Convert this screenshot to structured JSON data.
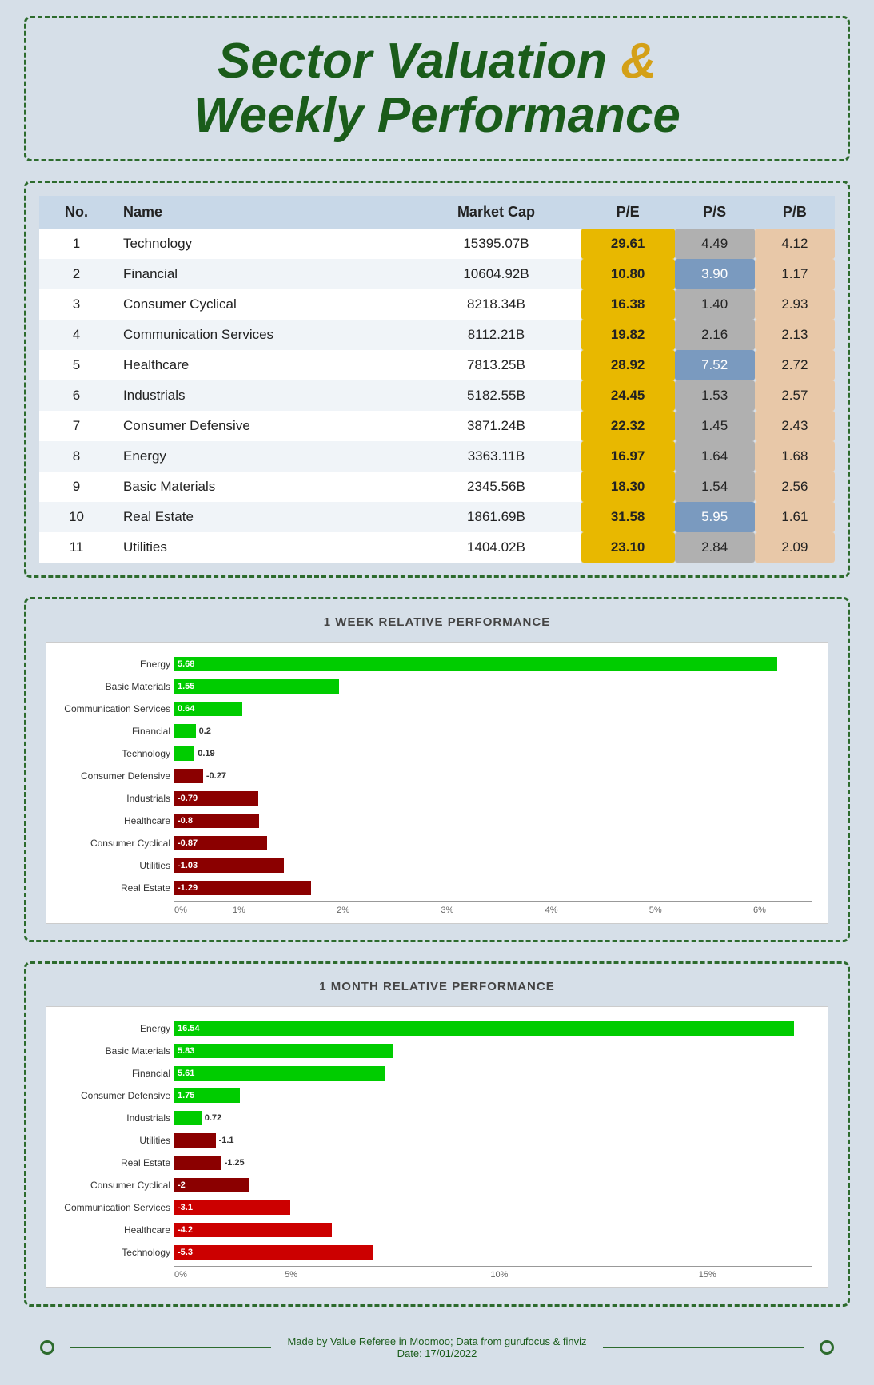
{
  "title": {
    "line1": "Sector Valuation ",
    "ampersand": "&",
    "line2": "Weekly Performance"
  },
  "table": {
    "headers": [
      "No.",
      "Name",
      "Market Cap",
      "P/E",
      "P/S",
      "P/B"
    ],
    "rows": [
      {
        "no": 1,
        "name": "Technology",
        "market_cap": "15395.07B",
        "pe": "29.61",
        "ps": "4.49",
        "pb": "4.12"
      },
      {
        "no": 2,
        "name": "Financial",
        "market_cap": "10604.92B",
        "pe": "10.80",
        "ps": "3.90",
        "pb": "1.17"
      },
      {
        "no": 3,
        "name": "Consumer Cyclical",
        "market_cap": "8218.34B",
        "pe": "16.38",
        "ps": "1.40",
        "pb": "2.93"
      },
      {
        "no": 4,
        "name": "Communication Services",
        "market_cap": "8112.21B",
        "pe": "19.82",
        "ps": "2.16",
        "pb": "2.13"
      },
      {
        "no": 5,
        "name": "Healthcare",
        "market_cap": "7813.25B",
        "pe": "28.92",
        "ps": "7.52",
        "pb": "2.72"
      },
      {
        "no": 6,
        "name": "Industrials",
        "market_cap": "5182.55B",
        "pe": "24.45",
        "ps": "1.53",
        "pb": "2.57"
      },
      {
        "no": 7,
        "name": "Consumer Defensive",
        "market_cap": "3871.24B",
        "pe": "22.32",
        "ps": "1.45",
        "pb": "2.43"
      },
      {
        "no": 8,
        "name": "Energy",
        "market_cap": "3363.11B",
        "pe": "16.97",
        "ps": "1.64",
        "pb": "1.68"
      },
      {
        "no": 9,
        "name": "Basic Materials",
        "market_cap": "2345.56B",
        "pe": "18.30",
        "ps": "1.54",
        "pb": "2.56"
      },
      {
        "no": 10,
        "name": "Real Estate",
        "market_cap": "1861.69B",
        "pe": "31.58",
        "ps": "5.95",
        "pb": "1.61"
      },
      {
        "no": 11,
        "name": "Utilities",
        "market_cap": "1404.02B",
        "pe": "23.10",
        "ps": "2.84",
        "pb": "2.09"
      }
    ]
  },
  "week_chart": {
    "title": "1 WEEK RELATIVE PERFORMANCE",
    "bars": [
      {
        "label": "Energy",
        "value": 5.68
      },
      {
        "label": "Basic Materials",
        "value": 1.55
      },
      {
        "label": "Communication Services",
        "value": 0.64
      },
      {
        "label": "Financial",
        "value": 0.2
      },
      {
        "label": "Technology",
        "value": 0.19
      },
      {
        "label": "Consumer Defensive",
        "value": -0.27
      },
      {
        "label": "Industrials",
        "value": -0.79
      },
      {
        "label": "Healthcare",
        "value": -0.8
      },
      {
        "label": "Consumer Cyclical",
        "value": -0.87
      },
      {
        "label": "Utilities",
        "value": -1.03
      },
      {
        "label": "Real Estate",
        "value": -1.29
      }
    ],
    "x_ticks": [
      "0%",
      "1%",
      "2%",
      "3%",
      "4%",
      "5%",
      "6%"
    ],
    "max": 6
  },
  "month_chart": {
    "title": "1 MONTH RELATIVE PERFORMANCE",
    "bars": [
      {
        "label": "Energy",
        "value": 16.54
      },
      {
        "label": "Basic Materials",
        "value": 5.83
      },
      {
        "label": "Financial",
        "value": 5.61
      },
      {
        "label": "Consumer Defensive",
        "value": 1.75
      },
      {
        "label": "Industrials",
        "value": 0.72
      },
      {
        "label": "Utilities",
        "value": -1.1
      },
      {
        "label": "Real Estate",
        "value": -1.25
      },
      {
        "label": "Consumer Cyclical",
        "value": -2
      },
      {
        "label": "Communication Services",
        "value": -3.1
      },
      {
        "label": "Healthcare",
        "value": -4.2
      },
      {
        "label": "Technology",
        "value": -5.3
      }
    ],
    "x_ticks": [
      "0%",
      "5%",
      "10%",
      "15%"
    ],
    "max": 17
  },
  "footer": {
    "line1": "Made by Value Referee in Moomoo; Data from gurufocus & finviz",
    "line2": "Date: 17/01/2022"
  }
}
